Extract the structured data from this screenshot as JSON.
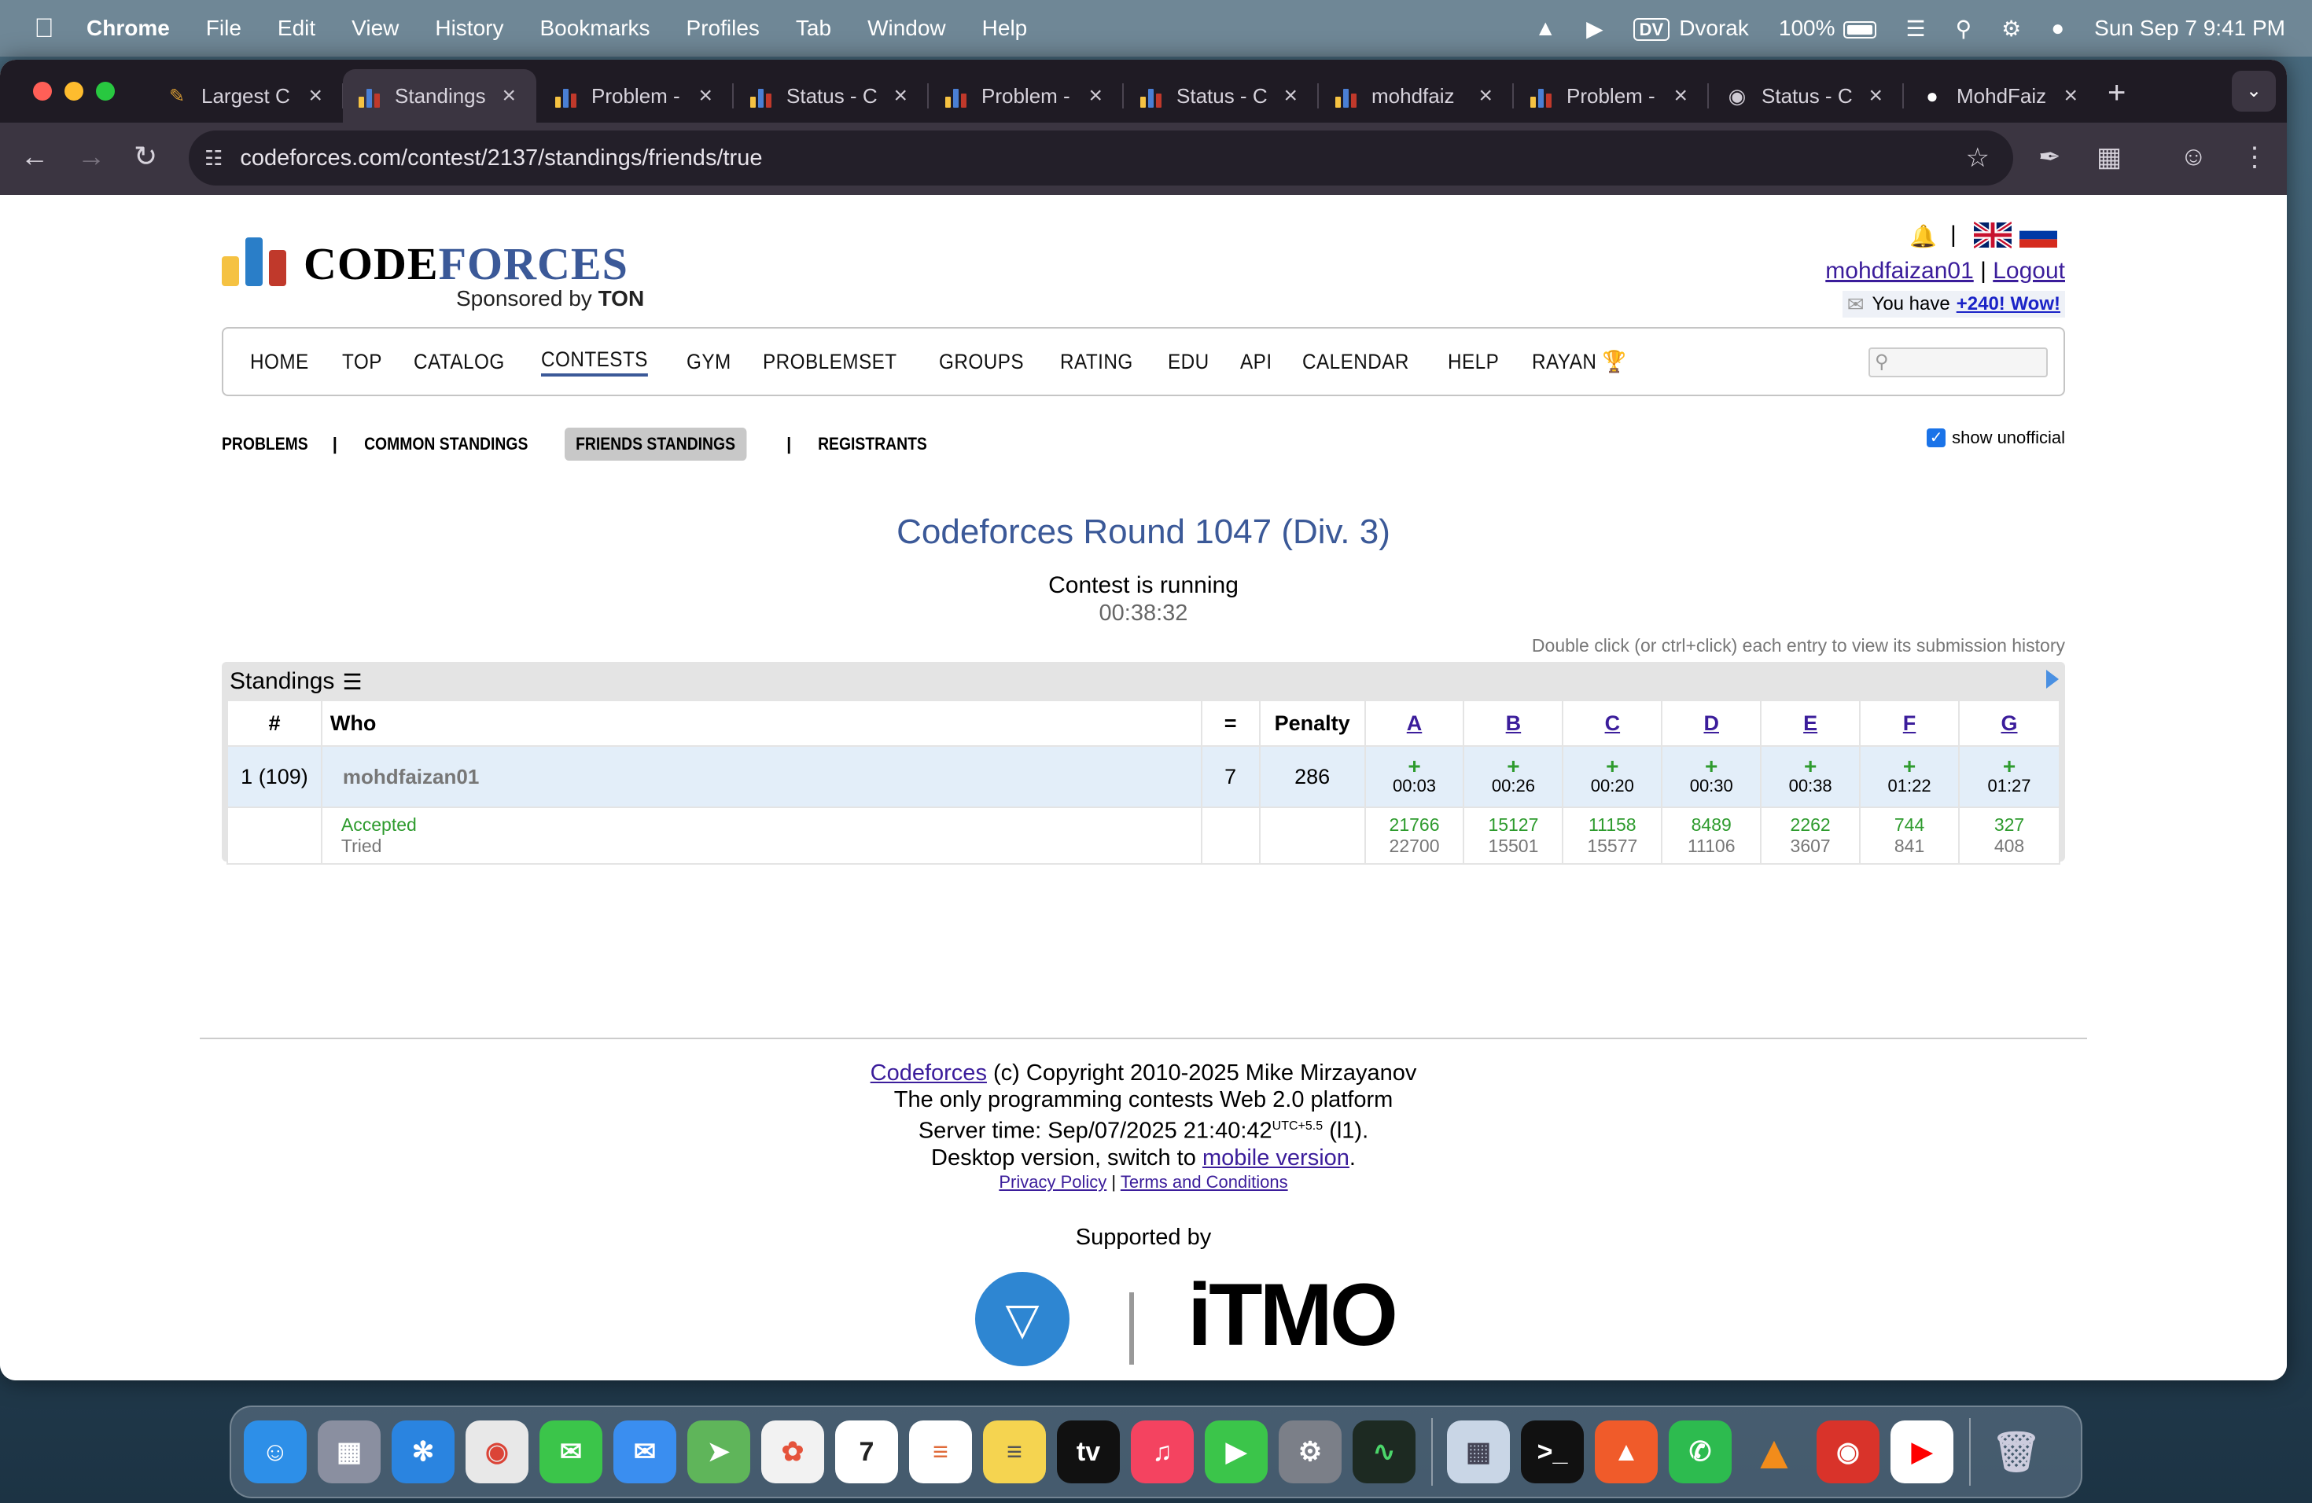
{
  "menubar": {
    "app": "Chrome",
    "items": [
      "File",
      "Edit",
      "View",
      "History",
      "Bookmarks",
      "Profiles",
      "Tab",
      "Window",
      "Help"
    ],
    "keyboard": "Dvorak",
    "keyboard_badge": "DV",
    "battery": "100%",
    "datetime": "Sun Sep 7  9:41 PM"
  },
  "tabs": [
    {
      "label": "Largest C",
      "icon": "clipboard-icon"
    },
    {
      "label": "Standings",
      "icon": "codeforces-icon",
      "active": true
    },
    {
      "label": "Problem -",
      "icon": "codeforces-icon"
    },
    {
      "label": "Status - C",
      "icon": "codeforces-icon"
    },
    {
      "label": "Problem -",
      "icon": "codeforces-icon"
    },
    {
      "label": "Status - C",
      "icon": "codeforces-icon"
    },
    {
      "label": "mohdfaiz",
      "icon": "codeforces-icon"
    },
    {
      "label": "Problem -",
      "icon": "codeforces-icon"
    },
    {
      "label": "Status - C",
      "icon": "globe-icon"
    },
    {
      "label": "MohdFaiz",
      "icon": "github-icon"
    }
  ],
  "address_bar": {
    "url": "codeforces.com/contest/2137/standings/friends/true"
  },
  "logo": {
    "word_a": "CODE",
    "word_b": "FORCES",
    "sponsored": "Sponsored by",
    "sponsor": "TON"
  },
  "header": {
    "username": "mohdfaizan01",
    "separator": "|",
    "logout": "Logout",
    "notif_prefix": "You have",
    "notif_link": "+240! Wow!"
  },
  "nav": [
    "HOME",
    "TOP",
    "CATALOG",
    "CONTESTS",
    "GYM",
    "PROBLEMSET",
    "GROUPS",
    "RATING",
    "EDU",
    "API",
    "CALENDAR",
    "HELP",
    "RAYAN"
  ],
  "nav_active": "CONTESTS",
  "subnav": [
    "PROBLEMS",
    "COMMON STANDINGS",
    "FRIENDS STANDINGS",
    "REGISTRANTS"
  ],
  "subnav_active": "FRIENDS STANDINGS",
  "show_unofficial": {
    "label": "show unofficial",
    "checked": true
  },
  "contest": {
    "title": "Codeforces Round 1047 (Div. 3)",
    "status": "Contest is running",
    "timer": "00:38:32",
    "hint": "Double click (or ctrl+click) each entry to view its submission history"
  },
  "standings": {
    "title": "Standings",
    "headers": {
      "rank": "#",
      "who": "Who",
      "solved": "=",
      "penalty": "Penalty"
    },
    "problems": [
      "A",
      "B",
      "C",
      "D",
      "E",
      "F",
      "G"
    ],
    "row": {
      "rank": "1 (109)",
      "who": "mohdfaizan01",
      "solved": "7",
      "penalty": "286",
      "results": [
        {
          "mark": "+",
          "time": "00:03"
        },
        {
          "mark": "+",
          "time": "00:26"
        },
        {
          "mark": "+",
          "time": "00:20"
        },
        {
          "mark": "+",
          "time": "00:30"
        },
        {
          "mark": "+",
          "time": "00:38"
        },
        {
          "mark": "+",
          "time": "01:22"
        },
        {
          "mark": "+",
          "time": "01:27"
        }
      ]
    },
    "stats_labels": {
      "accepted": "Accepted",
      "tried": "Tried"
    },
    "accepted": [
      "21766",
      "15127",
      "11158",
      "8489",
      "2262",
      "744",
      "327"
    ],
    "tried": [
      "22700",
      "15501",
      "15577",
      "11106",
      "3607",
      "841",
      "408"
    ]
  },
  "footer": {
    "site": "Codeforces",
    "copyright": "(c) Copyright 2010-2025 Mike Mirzayanov",
    "tagline": "The only programming contests Web 2.0 platform",
    "server_time_prefix": "Server time: Sep/07/2025 21:40:42",
    "server_tz": "UTC+5.5",
    "server_suffix": "(l1).",
    "desktop_prefix": "Desktop version, switch to",
    "mobile_link": "mobile version",
    "desktop_suffix": ".",
    "privacy": "Privacy Policy",
    "pipe": "|",
    "terms": "Terms and Conditions",
    "supported_by": "Supported by",
    "itmo": "iTMO"
  },
  "colors": {
    "cf_blue": "#3b5998",
    "accepted_green": "#2e9b2e",
    "link_purple": "#3b1d9b"
  }
}
